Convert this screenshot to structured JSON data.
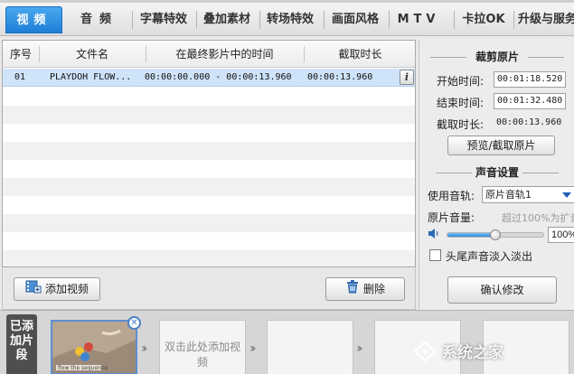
{
  "tabs": [
    {
      "label": "视频",
      "active": true
    },
    {
      "label": "音频"
    },
    {
      "label": "字幕特效"
    },
    {
      "label": "叠加素材"
    },
    {
      "label": "转场特效"
    },
    {
      "label": "画面风格"
    },
    {
      "label": "MTV"
    },
    {
      "label": "卡拉OK"
    },
    {
      "label": "升级与服务"
    }
  ],
  "table": {
    "headers": [
      "序号",
      "文件名",
      "在最终影片中的时间",
      "截取时长"
    ],
    "rows": [
      {
        "index": "01",
        "filename": "PLAYDOH FLOW...",
        "time_range": "00:00:00.000 - 00:00:13.960",
        "duration": "00:00:13.960"
      }
    ]
  },
  "actions": {
    "add_video": "添加视频",
    "delete": "删除"
  },
  "clip": {
    "title": "裁剪原片",
    "start_label": "开始时间:",
    "start_value": "00:01:18.520",
    "end_label": "结束时间:",
    "end_value": "00:01:32.480",
    "duration_label": "截取时长:",
    "duration_value": "00:00:13.960",
    "preview_button": "预览/截取原片"
  },
  "audio": {
    "title": "声音设置",
    "track_label": "使用音轨:",
    "track_value": "原片音轨1",
    "volume_label": "原片音量:",
    "volume_hint": "超过100%为扩音",
    "volume_value": "100%",
    "volume_level": 0.5,
    "fade_label": "头尾声音淡入淡出",
    "confirm_button": "确认修改"
  },
  "timeline": {
    "label": "已添加片段",
    "placeholder": "双击此处添加视频",
    "thumb_caption": "flow the sequence"
  },
  "watermark": "系统之家",
  "colors": {
    "tab_active": "#1d7fd6",
    "selected_row": "#cfe3f9",
    "slider": "#2b86d8"
  }
}
